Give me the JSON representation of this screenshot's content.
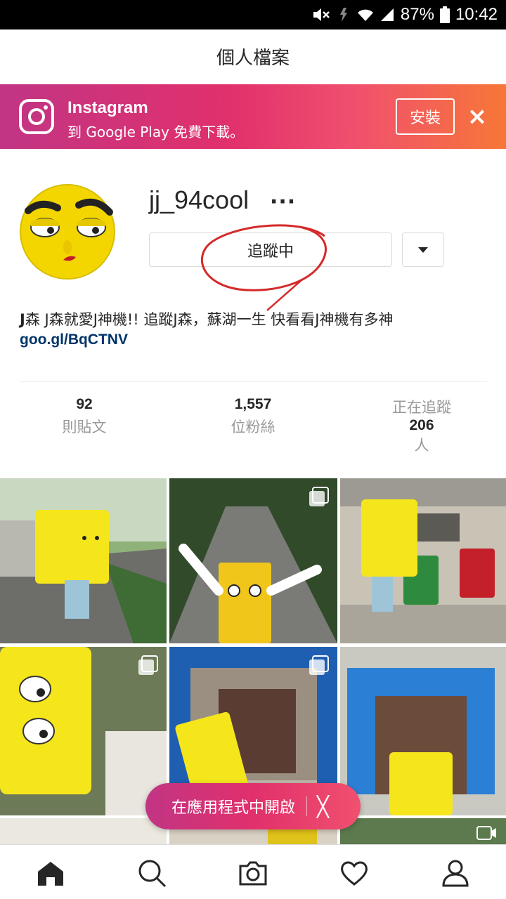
{
  "status_bar": {
    "battery": "87%",
    "time": "10:42"
  },
  "header": {
    "title": "個人檔案"
  },
  "banner": {
    "app_name": "Instagram",
    "subtitle": "到 Google Play 免費下載。",
    "install_label": "安裝",
    "close_glyph": "×"
  },
  "profile": {
    "username": "jj_94cool",
    "more": "···",
    "follow_label": "追蹤中",
    "bio_prefix": "J",
    "bio_text": "森 J森就愛J神機!! 追蹤J森，蘇湖一生 快看看J神機有多神",
    "link": "goo.gl/BqCTNV"
  },
  "stats": {
    "posts": {
      "value": "92",
      "label": "則貼文"
    },
    "followers": {
      "value": "1,557",
      "label": "位粉絲"
    },
    "following": {
      "label_top": "正在追蹤",
      "value": "206",
      "label_bottom": "人"
    }
  },
  "open_in_app": {
    "label": "在應用程式中開啟",
    "close": "╳"
  },
  "bottom_nav": [
    "home-icon",
    "search-icon",
    "camera-icon",
    "heart-icon",
    "profile-icon"
  ],
  "colors": {
    "brand_gradient_start": "#c13584",
    "brand_gradient_end": "#f77737",
    "link": "#003569",
    "annotation_red": "#d42a2a"
  }
}
